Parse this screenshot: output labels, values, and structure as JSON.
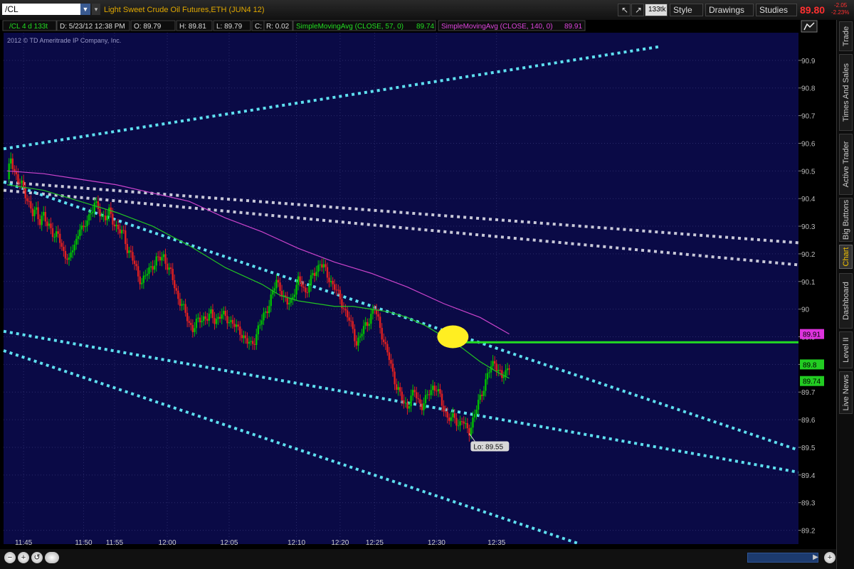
{
  "header": {
    "symbol": "/CL",
    "symbol_dropdown": "▼",
    "link_dropdown": "▾",
    "description": "Light Sweet Crude Oil Futures,ETH (JUN4 12)",
    "tool_btn_1": "↗",
    "aggregation": "133tk",
    "style_label": "Style",
    "drawings_label": "Drawings",
    "studies_label": "Studies",
    "last_price": "89.80",
    "net_change": "-2.05",
    "pct_change": "-2.23%"
  },
  "infobar": {
    "symbol": "/CL 4 d 133t",
    "date": "D: 5/23/12 12:38 PM",
    "open": "O: 89.79",
    "high": "H: 89.81",
    "low": "L: 89.79",
    "close": "C: 89.8",
    "range": "R: 0.02",
    "sma1_label": "SimpleMovingAvg (CLOSE, 57, 0)",
    "sma1_value": "89.74",
    "sma2_label": "SimpleMovingAvg (CLOSE, 140, 0)",
    "sma2_value": "89.91",
    "copyright": "2012 © TD Ameritrade IP Company, Inc.",
    "chart_icon": "line-chart-icon"
  },
  "sidebar": {
    "tabs": [
      "Trade",
      "Times And Sales",
      "Active Trader",
      "Big Buttons",
      "Chart",
      "Dashboard",
      "Level II",
      "Live News"
    ],
    "active": "Chart"
  },
  "colors": {
    "background": "#0a0a46",
    "grid": "#2a2a6a",
    "up_candle": "#00c000",
    "down_candle": "#e02020",
    "sma57": "#22c422",
    "sma140": "#cc44cc",
    "trend_cyan": "#5ee0f0",
    "trend_white": "#c8c8d8",
    "hline": "#22dd22",
    "highlight": "#ffee22"
  },
  "chart_data": {
    "type": "candlestick",
    "title": "/CL 4 d 133t",
    "ylim": [
      89.15,
      91.0
    ],
    "yticks": [
      89.2,
      89.3,
      89.4,
      89.5,
      89.6,
      89.7,
      89.8,
      89.9,
      90.0,
      90.1,
      90.2,
      90.3,
      90.4,
      90.5,
      90.6,
      90.7,
      90.8,
      90.9
    ],
    "ytick_labels": [
      "89.2",
      "89.3",
      "89.4",
      "89.5",
      "89.6",
      "89.7",
      "89.8",
      "89.9",
      "90",
      "90.1",
      "90.2",
      "90.3",
      "90.4",
      "90.5",
      "90.6",
      "90.7",
      "90.8",
      "90.9"
    ],
    "time_labels": [
      {
        "label": "11:45",
        "index": 9
      },
      {
        "label": "11:50",
        "index": 42
      },
      {
        "label": "11:55",
        "index": 59
      },
      {
        "label": "12:00",
        "index": 88
      },
      {
        "label": "12:05",
        "index": 122
      },
      {
        "label": "12:10",
        "index": 159
      },
      {
        "label": "12:20",
        "index": 183
      },
      {
        "label": "12:25",
        "index": 202
      },
      {
        "label": "12:30",
        "index": 236
      },
      {
        "label": "12:35",
        "index": 269
      }
    ],
    "xlim": [
      -2,
      435
    ],
    "close_path": [
      [
        0,
        90.47
      ],
      [
        2,
        90.55
      ],
      [
        4,
        90.5
      ],
      [
        6,
        90.46
      ],
      [
        8,
        90.45
      ],
      [
        10,
        90.42
      ],
      [
        12,
        90.38
      ],
      [
        14,
        90.34
      ],
      [
        16,
        90.36
      ],
      [
        18,
        90.32
      ],
      [
        20,
        90.34
      ],
      [
        22,
        90.3
      ],
      [
        24,
        90.3
      ],
      [
        26,
        90.26
      ],
      [
        28,
        90.27
      ],
      [
        30,
        90.22
      ],
      [
        32,
        90.2
      ],
      [
        34,
        90.17
      ],
      [
        36,
        90.22
      ],
      [
        38,
        90.25
      ],
      [
        40,
        90.3
      ],
      [
        42,
        90.28
      ],
      [
        44,
        90.33
      ],
      [
        46,
        90.35
      ],
      [
        48,
        90.38
      ],
      [
        50,
        90.36
      ],
      [
        52,
        90.34
      ],
      [
        54,
        90.33
      ],
      [
        56,
        90.35
      ],
      [
        58,
        90.32
      ],
      [
        60,
        90.3
      ],
      [
        62,
        90.28
      ],
      [
        64,
        90.27
      ],
      [
        66,
        90.22
      ],
      [
        68,
        90.2
      ],
      [
        70,
        90.16
      ],
      [
        72,
        90.12
      ],
      [
        74,
        90.1
      ],
      [
        76,
        90.12
      ],
      [
        78,
        90.14
      ],
      [
        80,
        90.16
      ],
      [
        82,
        90.18
      ],
      [
        84,
        90.18
      ],
      [
        86,
        90.19
      ],
      [
        88,
        90.16
      ],
      [
        90,
        90.13
      ],
      [
        92,
        90.08
      ],
      [
        94,
        90.04
      ],
      [
        96,
        90.02
      ],
      [
        98,
        89.98
      ],
      [
        100,
        89.95
      ],
      [
        102,
        89.93
      ],
      [
        104,
        89.95
      ],
      [
        106,
        89.96
      ],
      [
        108,
        89.97
      ],
      [
        110,
        89.97
      ],
      [
        112,
        89.98
      ],
      [
        114,
        89.96
      ],
      [
        116,
        89.97
      ],
      [
        118,
        89.98
      ],
      [
        120,
        89.97
      ],
      [
        122,
        89.96
      ],
      [
        124,
        89.95
      ],
      [
        126,
        89.93
      ],
      [
        128,
        89.92
      ],
      [
        130,
        89.9
      ],
      [
        132,
        89.88
      ],
      [
        134,
        89.87
      ],
      [
        136,
        89.89
      ],
      [
        138,
        89.93
      ],
      [
        140,
        89.96
      ],
      [
        142,
        89.99
      ],
      [
        144,
        90.02
      ],
      [
        146,
        90.06
      ],
      [
        148,
        90.1
      ],
      [
        150,
        90.08
      ],
      [
        152,
        90.04
      ],
      [
        154,
        90.02
      ],
      [
        156,
        90.03
      ],
      [
        158,
        90.07
      ],
      [
        160,
        90.1
      ],
      [
        162,
        90.09
      ],
      [
        164,
        90.06
      ],
      [
        166,
        90.09
      ],
      [
        168,
        90.12
      ],
      [
        170,
        90.14
      ],
      [
        172,
        90.17
      ],
      [
        174,
        90.15
      ],
      [
        176,
        90.12
      ],
      [
        178,
        90.1
      ],
      [
        180,
        90.08
      ],
      [
        182,
        90.05
      ],
      [
        184,
        90.02
      ],
      [
        186,
        89.99
      ],
      [
        188,
        89.96
      ],
      [
        190,
        89.92
      ],
      [
        192,
        89.88
      ],
      [
        194,
        89.9
      ],
      [
        196,
        89.93
      ],
      [
        198,
        89.95
      ],
      [
        200,
        89.98
      ],
      [
        202,
        90.0
      ],
      [
        204,
        89.96
      ],
      [
        206,
        89.91
      ],
      [
        208,
        89.86
      ],
      [
        210,
        89.82
      ],
      [
        212,
        89.77
      ],
      [
        214,
        89.72
      ],
      [
        216,
        89.69
      ],
      [
        218,
        89.66
      ],
      [
        220,
        89.65
      ],
      [
        222,
        89.68
      ],
      [
        224,
        89.7
      ],
      [
        226,
        89.67
      ],
      [
        228,
        89.65
      ],
      [
        230,
        89.67
      ],
      [
        232,
        89.7
      ],
      [
        234,
        89.72
      ],
      [
        236,
        89.71
      ],
      [
        238,
        89.68
      ],
      [
        240,
        89.64
      ],
      [
        242,
        89.61
      ],
      [
        244,
        89.6
      ],
      [
        246,
        89.61
      ],
      [
        248,
        89.58
      ],
      [
        250,
        89.6
      ],
      [
        252,
        89.57
      ],
      [
        254,
        89.56
      ],
      [
        256,
        89.6
      ],
      [
        258,
        89.64
      ],
      [
        260,
        89.68
      ],
      [
        262,
        89.72
      ],
      [
        264,
        89.76
      ],
      [
        266,
        89.79
      ],
      [
        268,
        89.81
      ],
      [
        270,
        89.78
      ],
      [
        272,
        89.75
      ],
      [
        274,
        89.77
      ],
      [
        276,
        89.8
      ]
    ],
    "sma57": [
      [
        0,
        90.45
      ],
      [
        20,
        90.43
      ],
      [
        40,
        90.39
      ],
      [
        60,
        90.35
      ],
      [
        80,
        90.3
      ],
      [
        100,
        90.23
      ],
      [
        120,
        90.15
      ],
      [
        140,
        90.09
      ],
      [
        150,
        90.05
      ],
      [
        160,
        90.03
      ],
      [
        170,
        90.02
      ],
      [
        180,
        90.01
      ],
      [
        190,
        90.01
      ],
      [
        200,
        90.0
      ],
      [
        210,
        89.99
      ],
      [
        220,
        89.97
      ],
      [
        230,
        89.94
      ],
      [
        240,
        89.9
      ],
      [
        250,
        89.86
      ],
      [
        260,
        89.81
      ],
      [
        270,
        89.77
      ],
      [
        276,
        89.75
      ]
    ],
    "sma140": [
      [
        0,
        90.5
      ],
      [
        20,
        90.49
      ],
      [
        40,
        90.47
      ],
      [
        60,
        90.45
      ],
      [
        80,
        90.42
      ],
      [
        100,
        90.39
      ],
      [
        120,
        90.33
      ],
      [
        140,
        90.28
      ],
      [
        160,
        90.22
      ],
      [
        180,
        90.17
      ],
      [
        200,
        90.13
      ],
      [
        220,
        90.08
      ],
      [
        240,
        90.02
      ],
      [
        260,
        89.97
      ],
      [
        276,
        89.91
      ]
    ],
    "trendlines_cyan": [
      {
        "from": [
          -2,
          90.58
        ],
        "to": [
          359,
          90.95
        ]
      },
      {
        "from": [
          -2,
          90.46
        ],
        "to": [
          435,
          89.49
        ]
      },
      {
        "from": [
          -2,
          89.92
        ],
        "to": [
          435,
          89.41
        ]
      },
      {
        "from": [
          -2,
          89.85
        ],
        "to": [
          315,
          89.15
        ]
      }
    ],
    "trendlines_white": [
      {
        "from": [
          -2,
          90.46
        ],
        "to": [
          435,
          90.24
        ]
      },
      {
        "from": [
          -2,
          90.43
        ],
        "to": [
          435,
          90.16
        ]
      }
    ],
    "horizontal_line": {
      "from_index": 250,
      "y": 89.88
    },
    "highlight_point": {
      "index": 245,
      "y": 89.9
    },
    "low_annotation": {
      "label": "Lo: 89.55",
      "index": 254,
      "y": 89.55
    },
    "price_labels": [
      {
        "value": 89.91,
        "text": "89.91",
        "color": "#dd33dd"
      },
      {
        "value": 89.8,
        "text": "89.8",
        "color": "#22cc22"
      },
      {
        "value": 89.74,
        "text": "89.74",
        "color": "#22cc22"
      }
    ]
  },
  "bottom": {
    "zoom_out": "−",
    "zoom_in": "+",
    "zoom_fit": "",
    "scroll_left": "◀",
    "scroll_right": "▶",
    "scroll_zoom_in": "+",
    "scroll_zoom_out": "−"
  }
}
